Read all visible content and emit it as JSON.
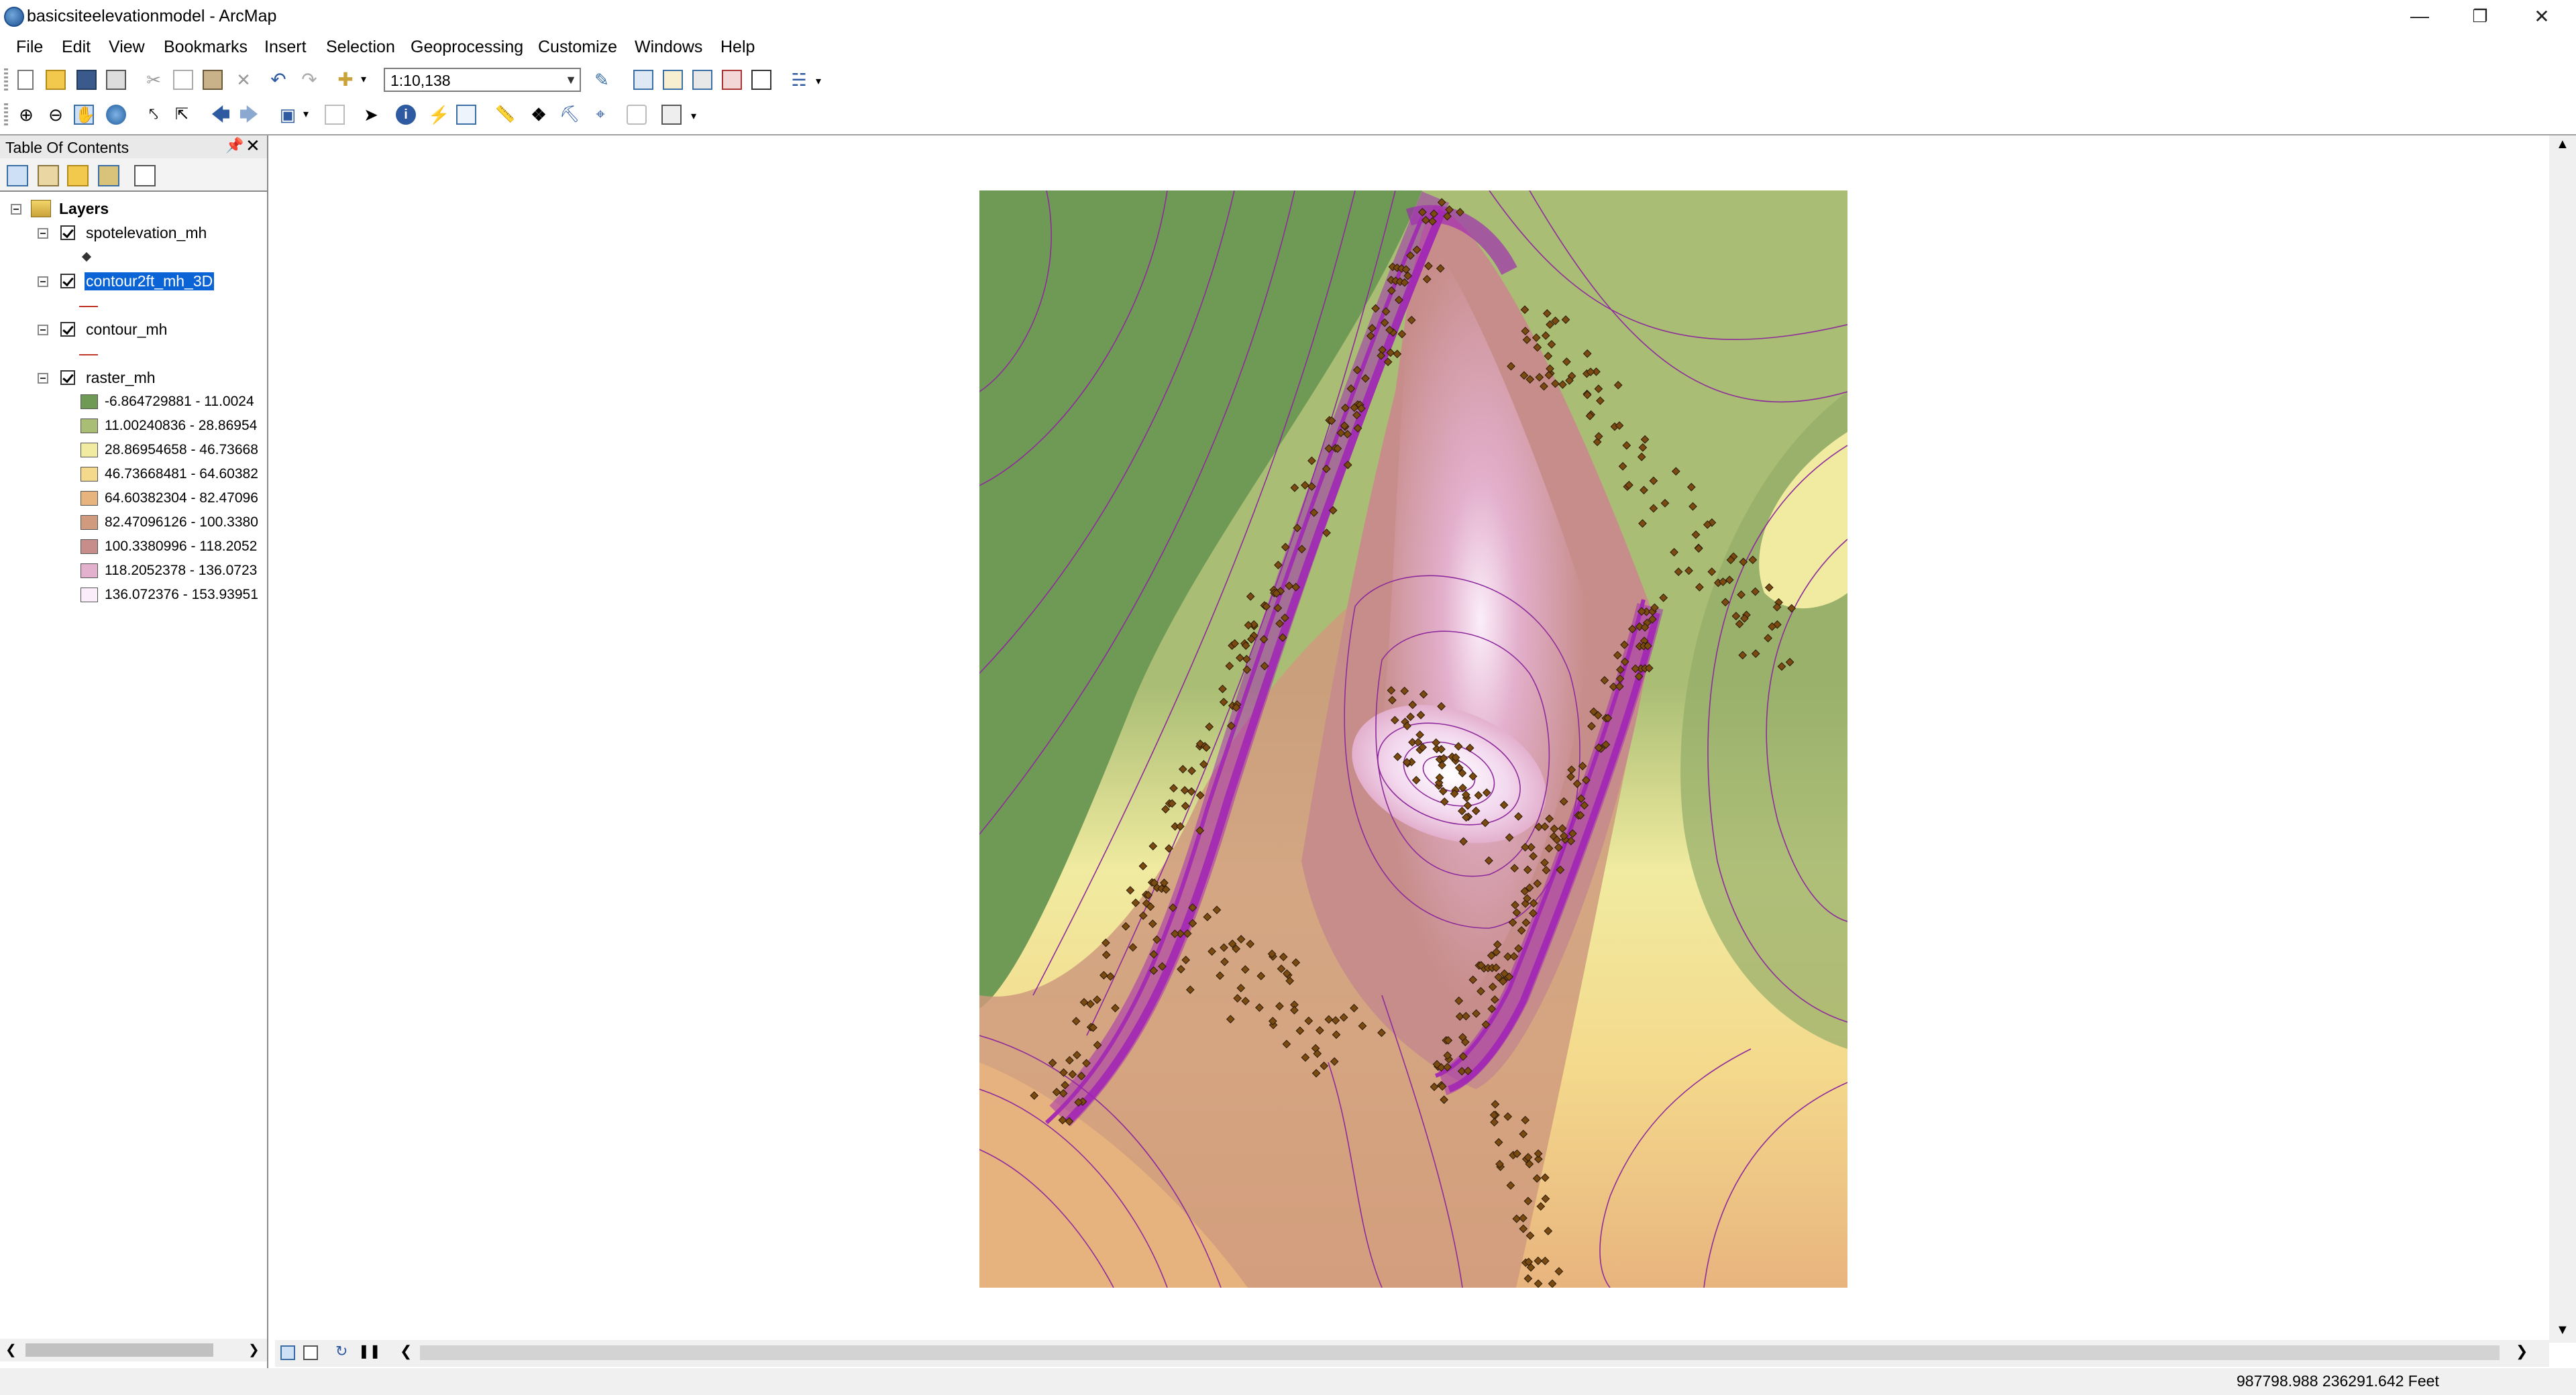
{
  "window": {
    "title": "basicsiteelevationmodel - ArcMap"
  },
  "menu": [
    "File",
    "Edit",
    "View",
    "Bookmarks",
    "Insert",
    "Selection",
    "Geoprocessing",
    "Customize",
    "Windows",
    "Help"
  ],
  "toolbar": {
    "scale": "1:10,138"
  },
  "toc": {
    "title": "Table Of Contents",
    "root": "Layers",
    "layers": [
      {
        "name": "spotelevation_mh",
        "checked": true,
        "symbol": "point"
      },
      {
        "name": "contour2ft_mh_3D",
        "checked": true,
        "selected": true,
        "symbol": "line",
        "symbol_color": "#c0392b"
      },
      {
        "name": "contour_mh",
        "checked": true,
        "symbol": "line",
        "symbol_color": "#c0392b"
      },
      {
        "name": "raster_mh",
        "checked": true,
        "symbol": "classes"
      }
    ],
    "legend": [
      {
        "label": "-6.864729881 - 11.0024",
        "color": "#6f9a55"
      },
      {
        "label": "11.00240836 - 28.86954",
        "color": "#a9bd74"
      },
      {
        "label": "28.86954658 - 46.73668",
        "color": "#f0eba0"
      },
      {
        "label": "46.73668481 - 64.60382",
        "color": "#f4d98c"
      },
      {
        "label": "64.60382304 - 82.47096",
        "color": "#e8b47e"
      },
      {
        "label": "82.47096126 - 100.3380",
        "color": "#cf9a7e"
      },
      {
        "label": "100.3380996 - 118.2052",
        "color": "#c78d8a"
      },
      {
        "label": "118.2052378 - 136.0723",
        "color": "#e3b0cd"
      },
      {
        "label": "136.072376 - 153.93951",
        "color": "#fbeefa"
      }
    ]
  },
  "status": {
    "coordinates": "987798.988  236291.642 Feet"
  }
}
